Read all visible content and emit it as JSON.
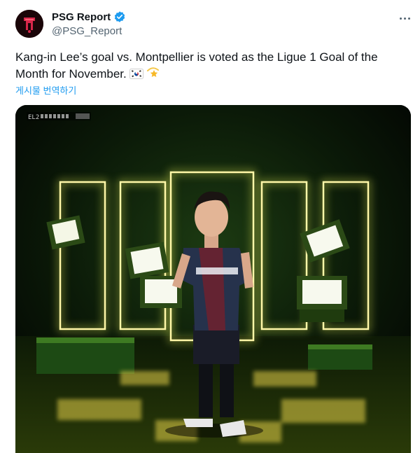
{
  "author": {
    "display_name": "PSG Report",
    "handle": "@PSG_Report",
    "verified": true,
    "avatar_icon": "psg-report-logo"
  },
  "tweet": {
    "text_line1": "Kang-in Lee’s goal vs. Montpellier is voted as the Ligue 1 Goal of the",
    "text_line2": "Month for November.",
    "emojis": [
      "flag-south-korea",
      "dizzy-star"
    ],
    "translate_label": "게시물 번역하기"
  },
  "media": {
    "overlay_caption": "EL2",
    "description_icon": "video-player-image"
  },
  "colors": {
    "accent": "#1d9bf0",
    "text_primary": "#0f1419",
    "text_secondary": "#536471",
    "glow": "#f2e86a"
  }
}
